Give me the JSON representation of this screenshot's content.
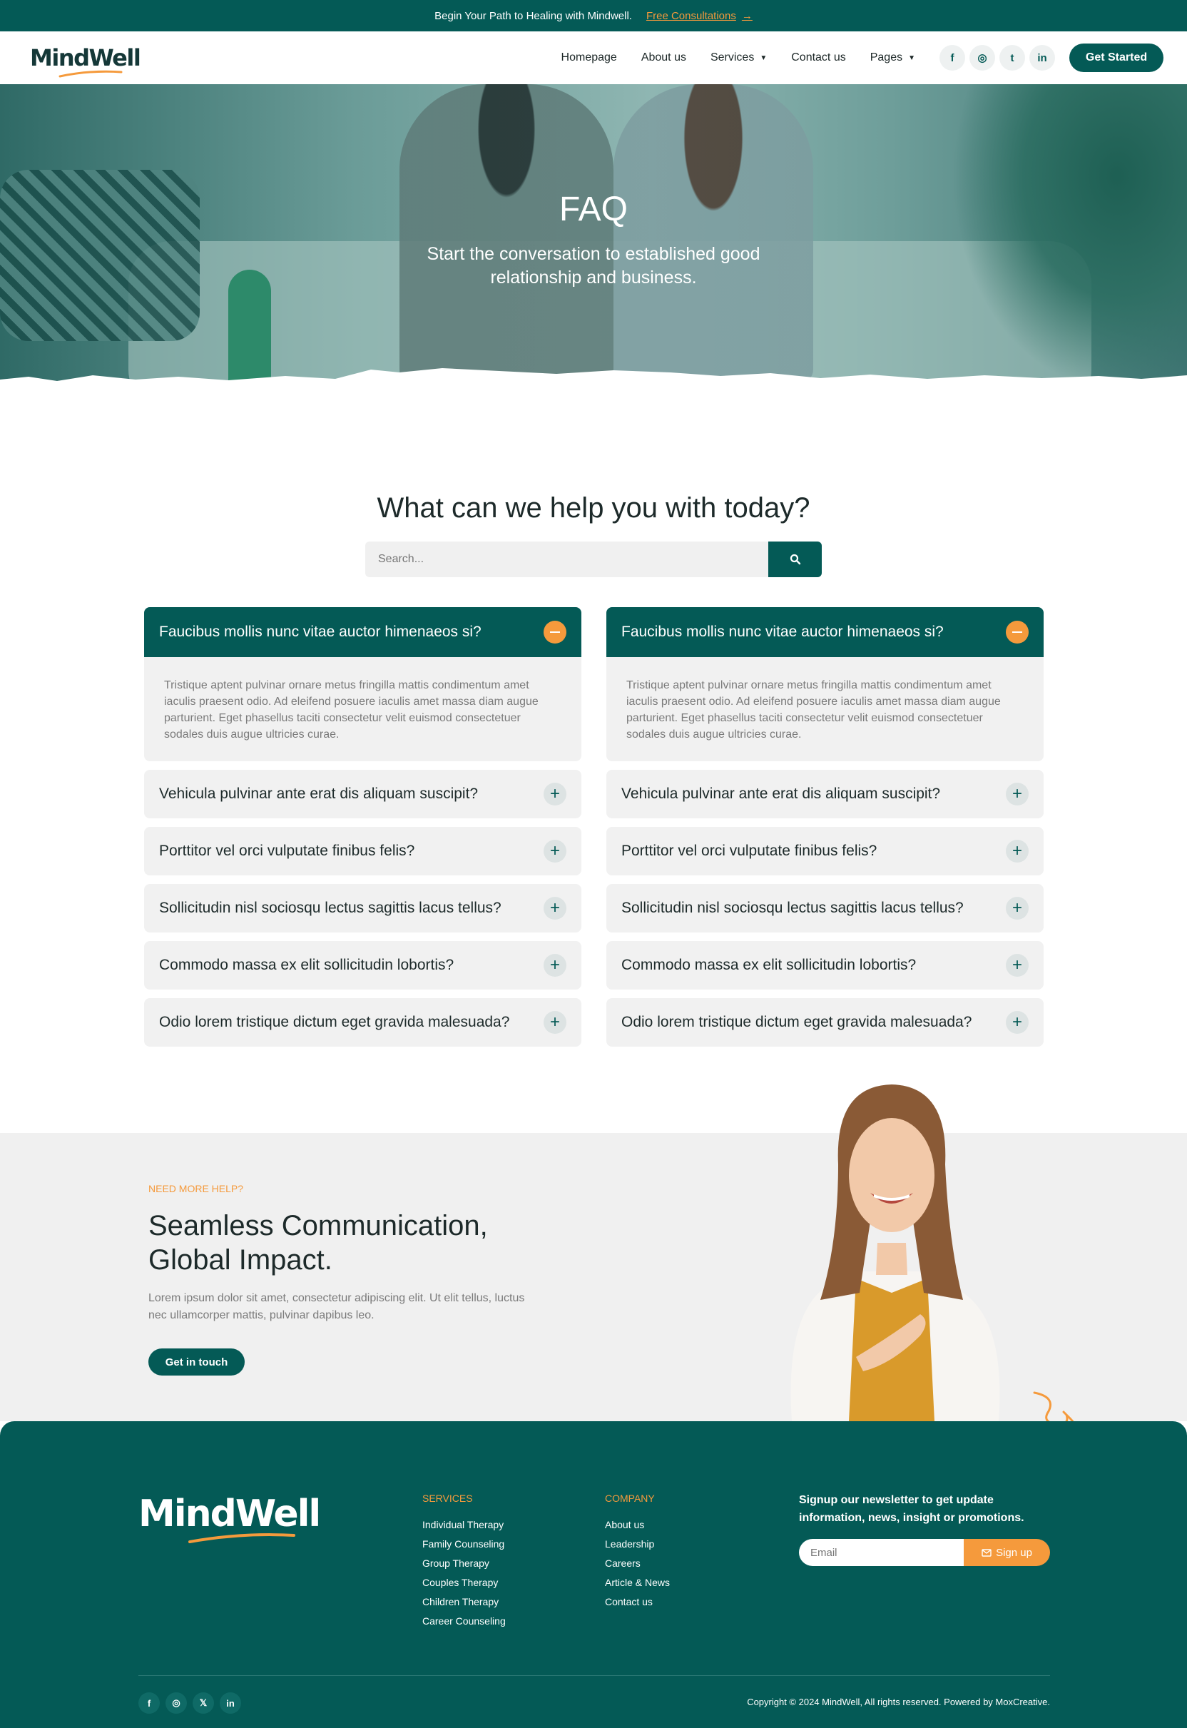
{
  "topbar": {
    "message": "Begin Your Path to Healing with Mindwell.",
    "cta": "Free Consultations",
    "cta_arrow": "→"
  },
  "nav": {
    "logo": "MindWell",
    "items": [
      {
        "label": "Homepage"
      },
      {
        "label": "About us"
      },
      {
        "label": "Services",
        "dropdown": "⌄"
      },
      {
        "label": "Contact us"
      },
      {
        "label": "Pages",
        "dropdown": "⌄"
      }
    ],
    "socials": [
      {
        "icon": "facebook-icon",
        "glyph": "f"
      },
      {
        "icon": "instagram-icon",
        "glyph": "◎"
      },
      {
        "icon": "twitter-icon",
        "glyph": "t"
      },
      {
        "icon": "linkedin-icon",
        "glyph": "in"
      }
    ],
    "cta": "Get Started"
  },
  "hero": {
    "title": "FAQ",
    "subtitle": "Start the conversation to established good relationship and business."
  },
  "help": {
    "heading": "What can we help you with today?",
    "search_placeholder": "Search..."
  },
  "faq": {
    "open_question": "Faucibus mollis nunc vitae auctor himenaeos si?",
    "open_answer": "Tristique aptent pulvinar ornare metus fringilla mattis condimentum amet iaculis praesent odio. Ad eleifend posuere iaculis amet massa diam augue parturient. Eget phasellus taciti consectetur velit euismod consectetuer sodales duis augue ultricies curae.",
    "questions": [
      "Vehicula pulvinar ante erat dis aliquam suscipit?",
      "Porttitor vel orci vulputate finibus felis?",
      "Sollicitudin nisl sociosqu lectus sagittis lacus tellus?",
      "Commodo massa ex elit sollicitudin lobortis?",
      "Odio lorem tristique dictum eget gravida malesuada?"
    ]
  },
  "cta_section": {
    "eyebrow": "NEED MORE HELP?",
    "title": "Seamless Communication, Global Impact.",
    "text": "Lorem ipsum dolor sit amet, consectetur adipiscing elit. Ut elit tellus, luctus nec ullamcorper mattis, pulvinar dapibus leo.",
    "button": "Get in touch"
  },
  "footer": {
    "logo": "MindWell",
    "services_title": "SERVICES",
    "services": [
      "Individual Therapy",
      "Family Counseling",
      "Group Therapy",
      "Couples Therapy",
      "Children Therapy",
      "Career Counseling"
    ],
    "company_title": "COMPANY",
    "company": [
      "About us",
      "Leadership",
      "Careers",
      "Article & News",
      "Contact us"
    ],
    "newsletter": "Signup our newsletter to get update information, news, insight or promotions.",
    "email_placeholder": "Email",
    "signup": "Sign up",
    "socials": [
      {
        "icon": "facebook-icon",
        "glyph": "f"
      },
      {
        "icon": "instagram-icon",
        "glyph": "◎"
      },
      {
        "icon": "x-icon",
        "glyph": "𝕏"
      },
      {
        "icon": "linkedin-icon",
        "glyph": "in"
      }
    ],
    "copyright": "Copyright © 2024 MindWell, All rights reserved. Powered by MoxCreative."
  },
  "colors": {
    "brand": "#045a56",
    "accent": "#f59a3c",
    "panel": "#f1f1f1"
  }
}
